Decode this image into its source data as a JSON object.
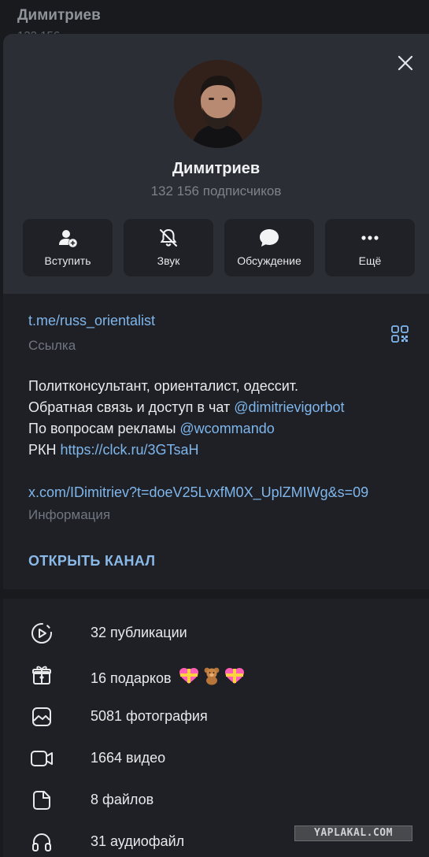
{
  "background": {
    "title": "Димитриев",
    "subtitle": "132 156"
  },
  "profile": {
    "name": "Димитриев",
    "subscribers": "132 156 подписчиков"
  },
  "actions": [
    {
      "label": "Вступить",
      "icon": "user-add-icon"
    },
    {
      "label": "Звук",
      "icon": "bell-off-icon"
    },
    {
      "label": "Обсуждение",
      "icon": "chat-bubble-icon"
    },
    {
      "label": "Ещё",
      "icon": "more-dots-icon"
    }
  ],
  "info": {
    "link": "t.me/russ_orientalist",
    "link_caption": "Ссылка",
    "bio": {
      "line1": "Политконсультант, ориенталист, одессит.",
      "line2_text": "Обратная связь и доступ в чат ",
      "line2_link": "@dimitrievigorbot",
      "line3_text": "По вопросам рекламы ",
      "line3_link": "@wcommando",
      "line4_text": "РКН ",
      "line4_link": "https://clck.ru/3GTsaH",
      "line5_link": "x.com/IDimitriev?t=doeV25LvxfM0X_UplZMIWg&s=09"
    },
    "bio_caption": "Информация",
    "open_channel": "ОТКРЫТЬ КАНАЛ"
  },
  "media": [
    {
      "label": "32 публикации",
      "icon": "story-play-icon"
    },
    {
      "label": "16 подарков",
      "icon": "gift-icon"
    },
    {
      "label": "5081 фотография",
      "icon": "photo-icon"
    },
    {
      "label": "1664 видео",
      "icon": "video-icon"
    },
    {
      "label": "8 файлов",
      "icon": "file-icon"
    },
    {
      "label": "31 аудиофайл",
      "icon": "headphones-icon"
    }
  ],
  "watermark": "YAPLAKAL.COM",
  "colors": {
    "accent_link": "#7eb6ec",
    "panel": "#1f2025",
    "header": "#2b2e35"
  }
}
